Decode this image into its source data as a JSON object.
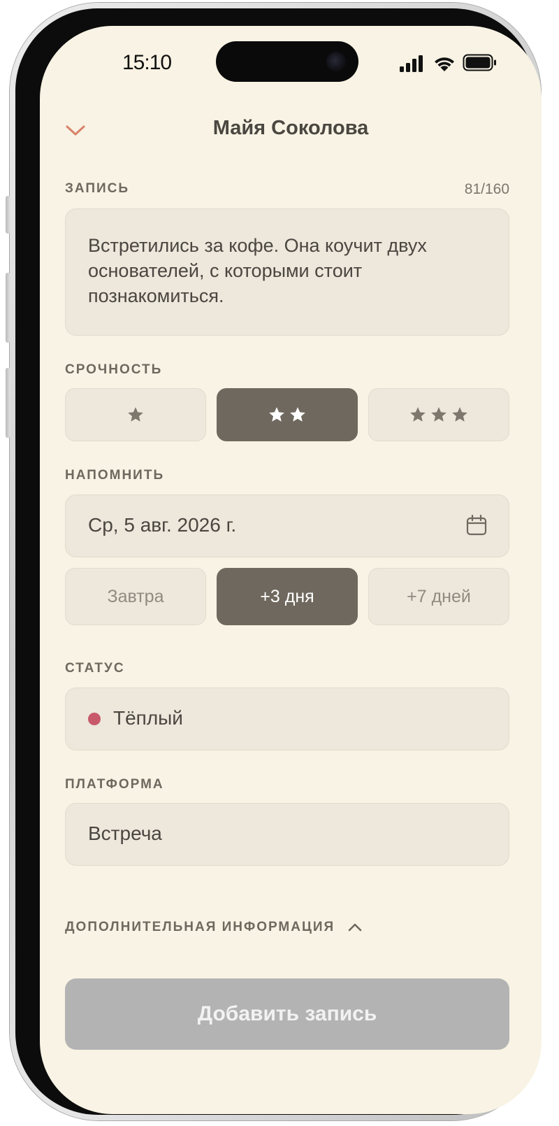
{
  "status_bar": {
    "time": "15:10"
  },
  "header": {
    "title": "Майя Соколова"
  },
  "note": {
    "label": "ЗАПИСЬ",
    "counter": "81/160",
    "text": "Встретились за кофе. Она коучит двух основателей, с которыми стоит познакомиться."
  },
  "urgency": {
    "label": "СРОЧНОСТЬ",
    "options": [
      {
        "stars": 1,
        "selected": false
      },
      {
        "stars": 2,
        "selected": true
      },
      {
        "stars": 3,
        "selected": false
      }
    ]
  },
  "reminder": {
    "label": "НАПОМНИТЬ",
    "date": "Ср, 5 авг. 2026 г.",
    "quick_options": [
      {
        "label": "Завтра",
        "selected": false
      },
      {
        "label": "+3 дня",
        "selected": true
      },
      {
        "label": "+7 дней",
        "selected": false
      }
    ]
  },
  "status": {
    "label": "СТАТУС",
    "value": "Тёплый",
    "dot_color": "#c8596b"
  },
  "platform": {
    "label": "ПЛАТФОРМА",
    "value": "Встреча"
  },
  "additional": {
    "label": "ДОПОЛНИТЕЛЬНАЯ ИНФОРМАЦИЯ",
    "expanded": true
  },
  "submit": {
    "label": "Добавить запись"
  },
  "colors": {
    "background": "#f8f3e4",
    "field": "#ede7dc",
    "selected": "#6f685e",
    "accent": "#d9826a",
    "submit_disabled": "#b3b3b3"
  },
  "icons": [
    "chevron-down-icon",
    "calendar-icon",
    "star-icon",
    "chevron-up-icon",
    "signal-icon",
    "wifi-icon",
    "battery-icon"
  ]
}
